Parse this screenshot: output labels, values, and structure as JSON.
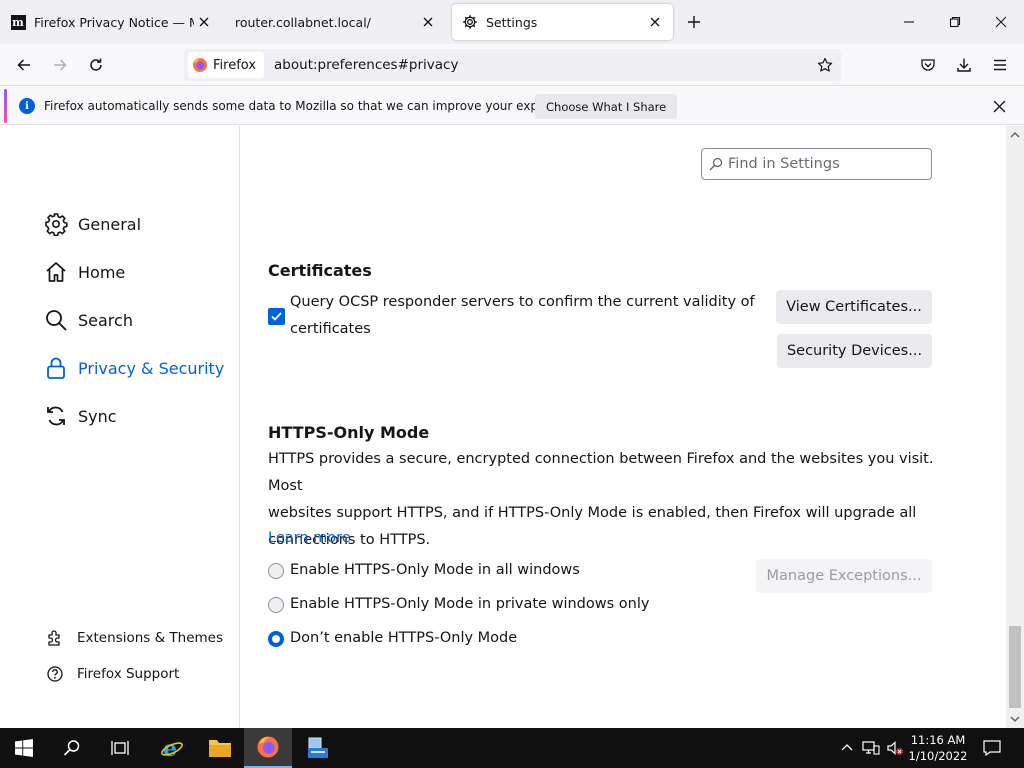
{
  "tabs": [
    {
      "title": "Firefox Privacy Notice — Mozilla",
      "icon": "mozilla-m-icon"
    },
    {
      "title": "router.collabnet.local/",
      "icon": "none"
    },
    {
      "title": "Settings",
      "icon": "gear-icon",
      "active": true
    }
  ],
  "urlbar": {
    "identity_label": "Firefox",
    "url": "about:preferences#privacy"
  },
  "notification": {
    "message": "Firefox automatically sends some data to Mozilla so that we can improve your experience.",
    "button": "Choose What I Share"
  },
  "sidebar": {
    "categories": [
      {
        "label": "General",
        "icon": "gear-icon"
      },
      {
        "label": "Home",
        "icon": "home-icon"
      },
      {
        "label": "Search",
        "icon": "search-icon"
      },
      {
        "label": "Privacy & Security",
        "icon": "lock-icon",
        "selected": true
      },
      {
        "label": "Sync",
        "icon": "sync-icon"
      }
    ],
    "footer": [
      {
        "label": "Extensions & Themes",
        "icon": "puzzle-icon"
      },
      {
        "label": "Firefox Support",
        "icon": "help-icon"
      }
    ]
  },
  "find": {
    "placeholder": "Find in Settings"
  },
  "certificates": {
    "heading": "Certificates",
    "ocsp_line1": "Query OCSP responder servers to confirm the current validity of",
    "ocsp_line2": "certificates",
    "ocsp_checked": true,
    "view_button": "View Certificates...",
    "devices_button": "Security Devices..."
  },
  "https_only": {
    "heading": "HTTPS-Only Mode",
    "desc_line1": "HTTPS provides a secure, encrypted connection between Firefox and the websites you visit. Most",
    "desc_line2": "websites support HTTPS, and if HTTPS-Only Mode is enabled, then Firefox will upgrade all",
    "desc_line3": "connections to HTTPS.",
    "learn_more": "Learn more",
    "options": [
      {
        "label": "Enable HTTPS-Only Mode in all windows",
        "selected": false
      },
      {
        "label": "Enable HTTPS-Only Mode in private windows only",
        "selected": false
      },
      {
        "label": "Don’t enable HTTPS-Only Mode",
        "selected": true
      }
    ],
    "exceptions_button": "Manage Exceptions..."
  },
  "taskbar": {
    "time": "11:16 AM",
    "date": "1/10/2022"
  },
  "colors": {
    "accent": "#0061e0",
    "taskbar": "#101010"
  }
}
